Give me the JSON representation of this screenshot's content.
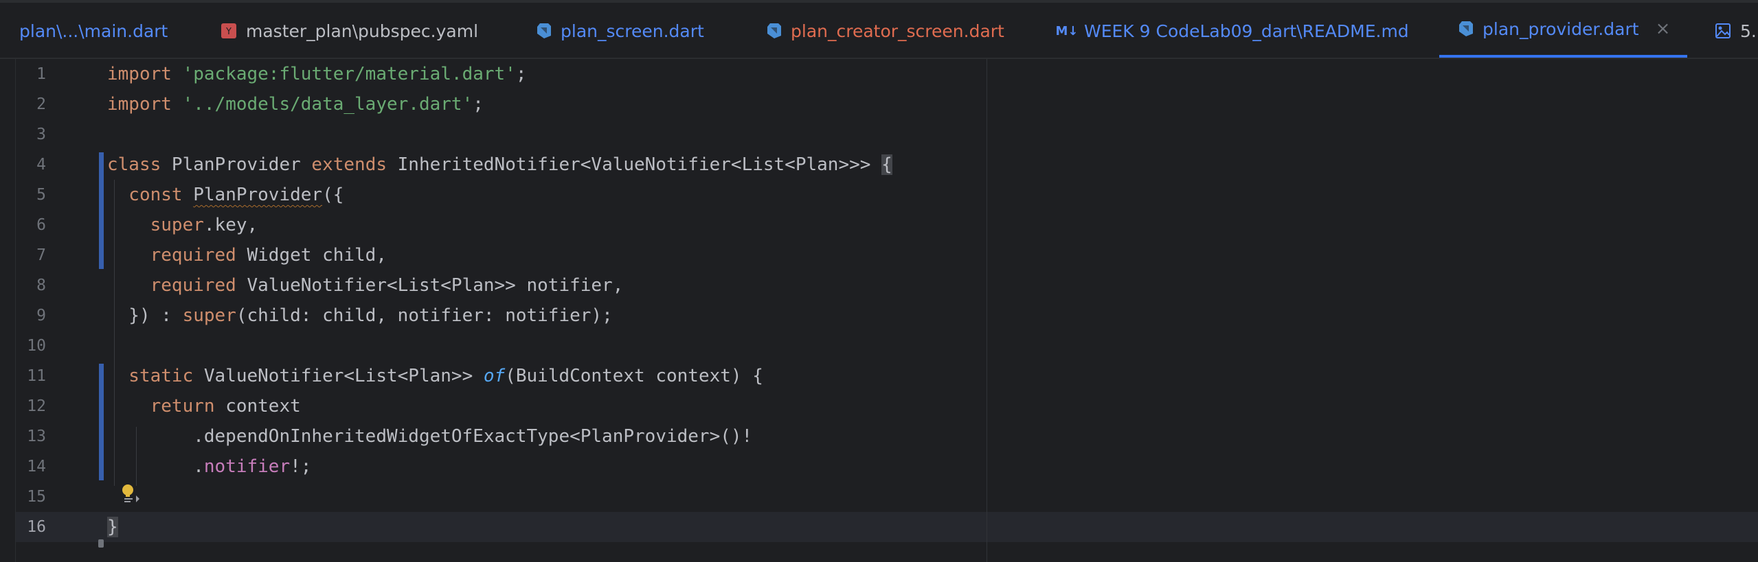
{
  "tabs": [
    {
      "label": "plan\\...\\main.dart",
      "color": "#548af7",
      "icon": "dart-file-icon"
    },
    {
      "label": "master_plan\\pubspec.yaml",
      "color": "#bcbec4",
      "icon": "yaml-file-icon"
    },
    {
      "label": "plan_screen.dart",
      "color": "#548af7",
      "icon": "dart-file-icon"
    },
    {
      "label": "plan_creator_screen.dart",
      "color": "#e06c50",
      "icon": "dart-file-icon"
    },
    {
      "label": "WEEK 9 CodeLab09_dart\\README.md",
      "color": "#548af7",
      "icon": "markdown-file-icon",
      "icon_text": "M↓"
    },
    {
      "label": "plan_provider.dart",
      "color": "#548af7",
      "icon": "dart-file-icon",
      "active": true,
      "close": "×"
    },
    {
      "label": "5.",
      "color": "#bcbec4",
      "icon": "image-file-icon"
    }
  ],
  "line_numbers": [
    "1",
    "2",
    "3",
    "4",
    "5",
    "6",
    "7",
    "8",
    "9",
    "10",
    "11",
    "12",
    "13",
    "14",
    "15",
    "16"
  ],
  "current_line": "16",
  "code_lines": [
    [
      {
        "t": "import ",
        "c": "kw"
      },
      {
        "t": "'package:flutter/material.dart'",
        "c": "str"
      },
      {
        "t": ";",
        "c": "plain"
      }
    ],
    [
      {
        "t": "import ",
        "c": "kw"
      },
      {
        "t": "'../models/data_layer.dart'",
        "c": "str"
      },
      {
        "t": ";",
        "c": "plain"
      }
    ],
    [],
    [
      {
        "t": "class ",
        "c": "kw"
      },
      {
        "t": "PlanProvider ",
        "c": "plain"
      },
      {
        "t": "extends ",
        "c": "kw"
      },
      {
        "t": "InheritedNotifier<ValueNotifier<List<Plan>>> ",
        "c": "plain"
      },
      {
        "t": "{",
        "c": "plain brace-hl"
      }
    ],
    [
      {
        "t": "  const ",
        "c": "kw"
      },
      {
        "t": "PlanProvider",
        "c": "plain squig"
      },
      {
        "t": "({",
        "c": "plain"
      }
    ],
    [
      {
        "t": "    super",
        "c": "kw"
      },
      {
        "t": ".key,",
        "c": "plain"
      }
    ],
    [
      {
        "t": "    required ",
        "c": "kw"
      },
      {
        "t": "Widget child,",
        "c": "plain"
      }
    ],
    [
      {
        "t": "    required ",
        "c": "kw"
      },
      {
        "t": "ValueNotifier<List<Plan>> notifier,",
        "c": "plain"
      }
    ],
    [
      {
        "t": "  }) : ",
        "c": "plain"
      },
      {
        "t": "super",
        "c": "kw"
      },
      {
        "t": "(child: child, notifier: notifier);",
        "c": "plain"
      }
    ],
    [],
    [
      {
        "t": "  static ",
        "c": "kw"
      },
      {
        "t": "ValueNotifier<List<Plan>> ",
        "c": "plain"
      },
      {
        "t": "of",
        "c": "fn"
      },
      {
        "t": "(BuildContext context) {",
        "c": "plain"
      }
    ],
    [
      {
        "t": "    return ",
        "c": "kw"
      },
      {
        "t": "context",
        "c": "plain"
      }
    ],
    [
      {
        "t": "        .dependOnInheritedWidgetOfExactType<PlanProvider>()!",
        "c": "plain"
      }
    ],
    [
      {
        "t": "        .",
        "c": "plain"
      },
      {
        "t": "notifier",
        "c": "prop"
      },
      {
        "t": "!;",
        "c": "plain"
      }
    ],
    [
      {
        "t": "  ",
        "c": "plain"
      }
    ],
    [
      {
        "t": "}",
        "c": "plain brace-hl"
      }
    ]
  ]
}
